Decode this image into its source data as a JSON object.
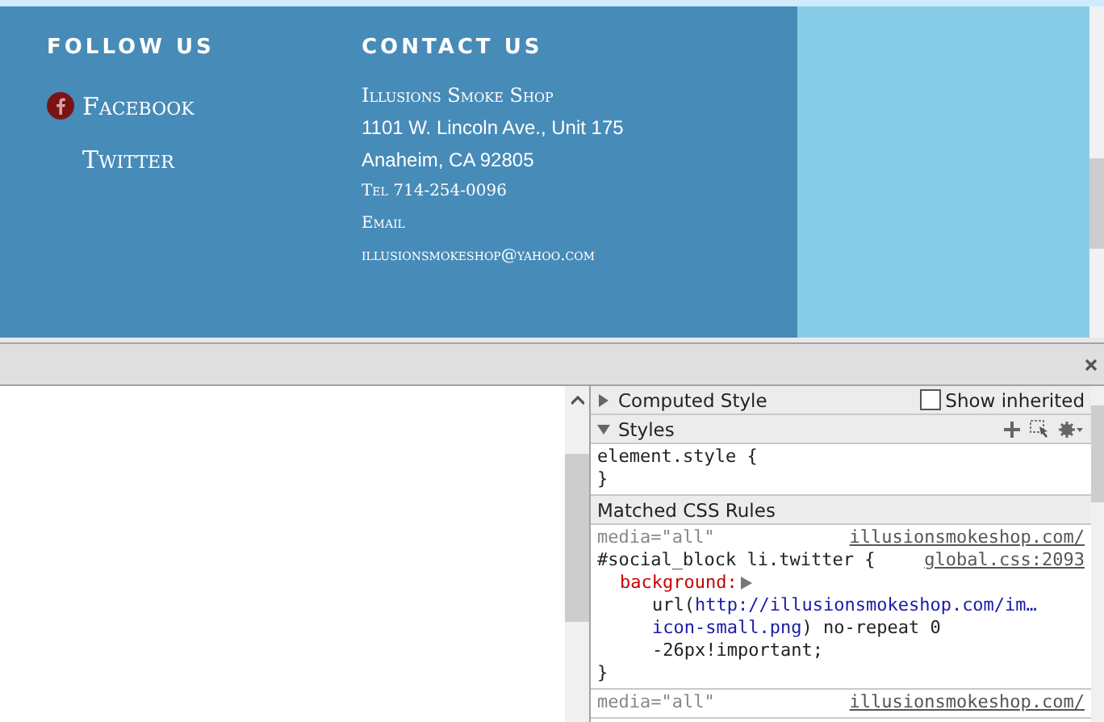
{
  "footer": {
    "follow_heading": "FOLLOW US",
    "social_links": [
      {
        "label": "Facebook",
        "kind": "facebook"
      },
      {
        "label": "Twitter",
        "kind": "twitter"
      }
    ],
    "contact_heading": "CONTACT US",
    "contact_lines": [
      {
        "text": "Illusions Smoke Shop",
        "kind": "name"
      },
      {
        "text": "1101 W. Lincoln Ave., Unit 175",
        "kind": "address"
      },
      {
        "text": "Anaheim, CA 92805",
        "kind": "address"
      },
      {
        "text": "Tel 714-254-0096",
        "kind": "small"
      },
      {
        "text": "Email",
        "kind": "small"
      },
      {
        "text": "illusionsmokeshop@yahoo.com",
        "kind": "small"
      }
    ]
  },
  "devtools": {
    "computed_style": {
      "label": "Computed Style",
      "expanded": false
    },
    "show_inherited": {
      "label": "Show inherited",
      "checked": false
    },
    "styles": {
      "label": "Styles",
      "expanded": true
    },
    "element_style": {
      "open": "element.style {",
      "close": "}"
    },
    "matched_header": "Matched CSS Rules",
    "rules": [
      {
        "media": "media=\"all\"",
        "source": "illusionsmokeshop.com/",
        "selector": "#social_block li.twitter {",
        "location": "global.css:2093",
        "properties": [
          {
            "name": "background:",
            "value_lines": [
              [
                {
                  "text": "url(",
                  "kind": "plain"
                },
                {
                  "text": "http://illusionsmokeshop.com/im…",
                  "kind": "link"
                }
              ],
              [
                {
                  "text": "icon-small.png",
                  "kind": "link"
                },
                {
                  "text": ") no-repeat 0",
                  "kind": "plain"
                }
              ],
              [
                {
                  "text": "-26px!important;",
                  "kind": "plain"
                }
              ]
            ]
          }
        ],
        "close": "}"
      },
      {
        "media": "media=\"all\"",
        "source": "illusionsmokeshop.com/"
      }
    ]
  }
}
